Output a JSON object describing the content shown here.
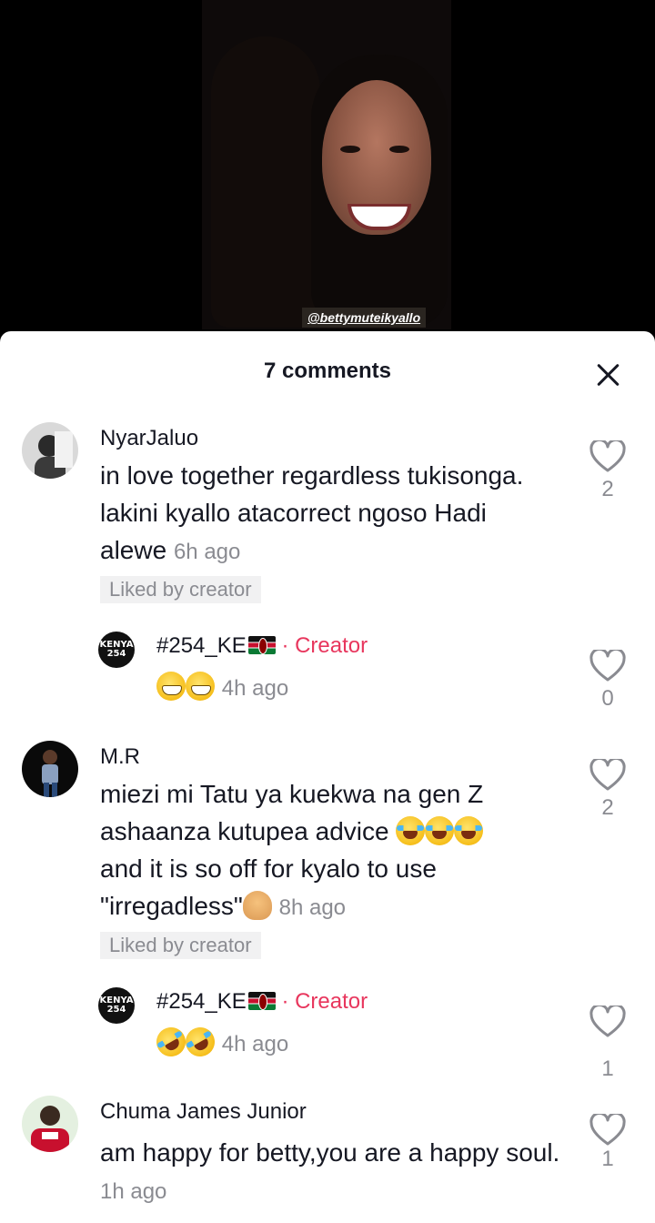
{
  "video": {
    "watermark": "@bettymuteikyallo"
  },
  "sheet": {
    "title": "7 comments"
  },
  "comments": [
    {
      "user": "NyarJaluo",
      "text": "in love together regardless tukisonga. lakini kyallo atacorrect ngoso Hadi alewe",
      "time": "6h ago",
      "liked_label": "Liked by creator",
      "likes": "2"
    },
    {
      "user": "#254_KE",
      "creator_label": "· Creator",
      "time": "4h ago",
      "likes": "0",
      "avatar_text": "KENYA 254"
    },
    {
      "user": "M.R",
      "text_lines": [
        "miezi mi Tatu ya kuekwa na gen Z",
        "ashaanza kutupea advice",
        "and it is so off for kyalo to use",
        "\"irregadless\""
      ],
      "time": "8h ago",
      "liked_label": "Liked by creator",
      "likes": "2"
    },
    {
      "user": "#254_KE",
      "creator_label": "· Creator",
      "time": "4h ago",
      "likes": "1",
      "avatar_text": "KENYA 254"
    },
    {
      "user": "Chuma James Junior",
      "text": "am happy for betty,you are a happy soul.",
      "time": "1h ago",
      "likes": "1"
    }
  ],
  "colors": {
    "creator": "#e8365d",
    "muted": "#8a8b91",
    "text": "#161823"
  }
}
